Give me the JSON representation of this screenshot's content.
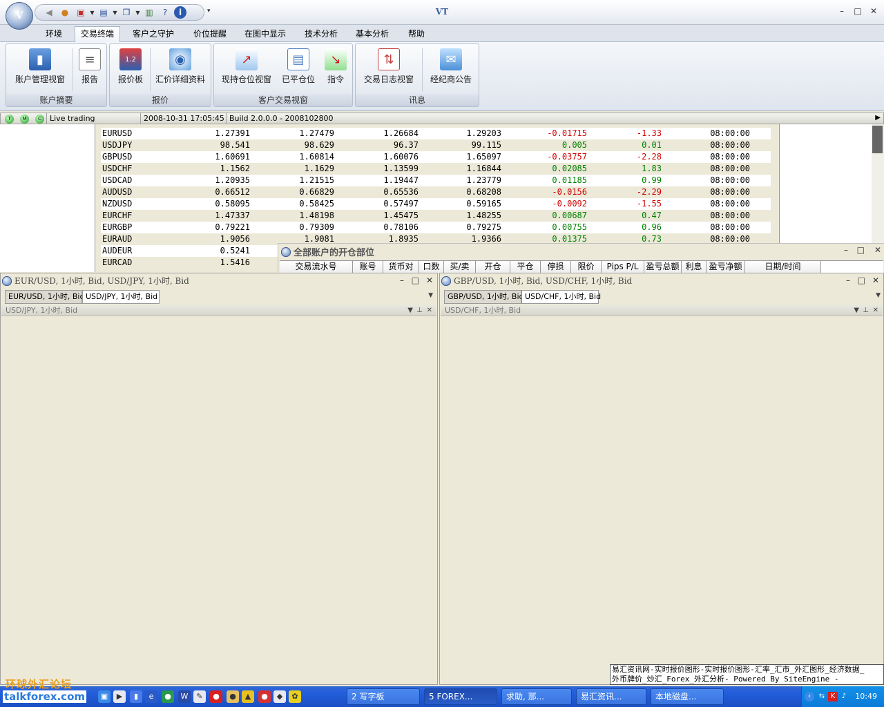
{
  "app": {
    "title": "VT",
    "window_controls": [
      "–",
      "□",
      "✕"
    ]
  },
  "ribbon_tabs": [
    "环境",
    "交易终端",
    "客户之守护",
    "价位提醒",
    "在图中显示",
    "技术分析",
    "基本分析",
    "帮助"
  ],
  "ribbon_groups": [
    {
      "label": "账户摘要",
      "buttons": [
        "账户管理视窗",
        "报告"
      ]
    },
    {
      "label": "报价",
      "buttons": [
        "报价板",
        "汇价详细资料"
      ]
    },
    {
      "label": "客户交易视窗",
      "buttons": [
        "现持仓位视窗",
        "已平仓位",
        "指令"
      ]
    },
    {
      "label": "讯息",
      "buttons": [
        "交易日志视窗",
        "经纪商公告"
      ]
    }
  ],
  "status": {
    "leds": [
      "T",
      "M",
      "C"
    ],
    "mode": "Live trading",
    "datetime": "2008-10-31 17:05:45",
    "build": "Build 2.0.0.0 - 2008102800"
  },
  "quotes": [
    {
      "symbol": "EURUSD",
      "bid": "1.27391",
      "ask": "1.27479",
      "low": "1.26684",
      "high": "1.29203",
      "change": "-0.01715",
      "pct": "-1.33",
      "time": "08:00:00"
    },
    {
      "symbol": "USDJPY",
      "bid": "98.541",
      "ask": "98.629",
      "low": "96.37",
      "high": "99.115",
      "change": "0.005",
      "pct": "0.01",
      "time": "08:00:00"
    },
    {
      "symbol": "GBPUSD",
      "bid": "1.60691",
      "ask": "1.60814",
      "low": "1.60076",
      "high": "1.65097",
      "change": "-0.03757",
      "pct": "-2.28",
      "time": "08:00:00"
    },
    {
      "symbol": "USDCHF",
      "bid": "1.1562",
      "ask": "1.1629",
      "low": "1.13599",
      "high": "1.16844",
      "change": "0.02085",
      "pct": "1.83",
      "time": "08:00:00"
    },
    {
      "symbol": "USDCAD",
      "bid": "1.20935",
      "ask": "1.21515",
      "low": "1.19447",
      "high": "1.23779",
      "change": "0.01185",
      "pct": "0.99",
      "time": "08:00:00"
    },
    {
      "symbol": "AUDUSD",
      "bid": "0.66512",
      "ask": "0.66829",
      "low": "0.65536",
      "high": "0.68208",
      "change": "-0.0156",
      "pct": "-2.29",
      "time": "08:00:00"
    },
    {
      "symbol": "NZDUSD",
      "bid": "0.58095",
      "ask": "0.58425",
      "low": "0.57497",
      "high": "0.59165",
      "change": "-0.0092",
      "pct": "-1.55",
      "time": "08:00:00"
    },
    {
      "symbol": "EURCHF",
      "bid": "1.47337",
      "ask": "1.48198",
      "low": "1.45475",
      "high": "1.48255",
      "change": "0.00687",
      "pct": "0.47",
      "time": "08:00:00"
    },
    {
      "symbol": "EURGBP",
      "bid": "0.79221",
      "ask": "0.79309",
      "low": "0.78106",
      "high": "0.79275",
      "change": "0.00755",
      "pct": "0.96",
      "time": "08:00:00"
    },
    {
      "symbol": "EURAUD",
      "bid": "1.9056",
      "ask": "1.9081",
      "low": "1.8935",
      "high": "1.9366",
      "change": "0.01375",
      "pct": "0.73",
      "time": "08:00:00"
    },
    {
      "symbol": "AUDEUR",
      "bid": "0.5241",
      "ask": "",
      "low": "",
      "high": "",
      "change": "",
      "pct": "",
      "time": ""
    },
    {
      "symbol": "EURCAD",
      "bid": "1.5416",
      "ask": "",
      "low": "",
      "high": "",
      "change": "",
      "pct": "",
      "time": ""
    }
  ],
  "positions_window": {
    "title": "全部账户的开仓部位",
    "columns": [
      "交易流水号",
      "账号",
      "货币对",
      "口数",
      "买/卖",
      "开仓",
      "平仓",
      "停损",
      "限价",
      "Pips P/L",
      "盈亏总额",
      "利息",
      "盈亏净额",
      "日期/时间"
    ]
  },
  "left_pane": {
    "title": "EUR/USD, 1小时, Bid, USD/JPY, 1小时, Bid",
    "tabs": [
      "EUR/USD, 1小时, Bid",
      "USD/JPY, 1小时, Bid"
    ],
    "active_chart": "USD/JPY, 1小时, Bid"
  },
  "right_pane": {
    "title": "GBP/USD, 1小时, Bid, USD/CHF, 1小时, Bid",
    "tabs": [
      "GBP/USD, 1小时, Bid",
      "USD/CHF, 1小时, Bid"
    ],
    "active_chart": "USD/CHF, 1小时, Bid"
  },
  "ticker": {
    "line1": "易汇资讯网-实时报价图形-实时报价图形-汇率_汇市_外汇图形_经济数据_",
    "line2": "外币牌价_炒汇_Forex_外汇分析- Powered By SiteEngine -"
  },
  "watermark": {
    "cn": "环球外汇论坛",
    "en": "talkforex.com"
  },
  "taskbar": {
    "tasks": [
      "2 写字板",
      "5 FOREX...",
      "求助, 那...",
      "易汇资讯...",
      "本地磁盘..."
    ],
    "clock": "10:49"
  }
}
